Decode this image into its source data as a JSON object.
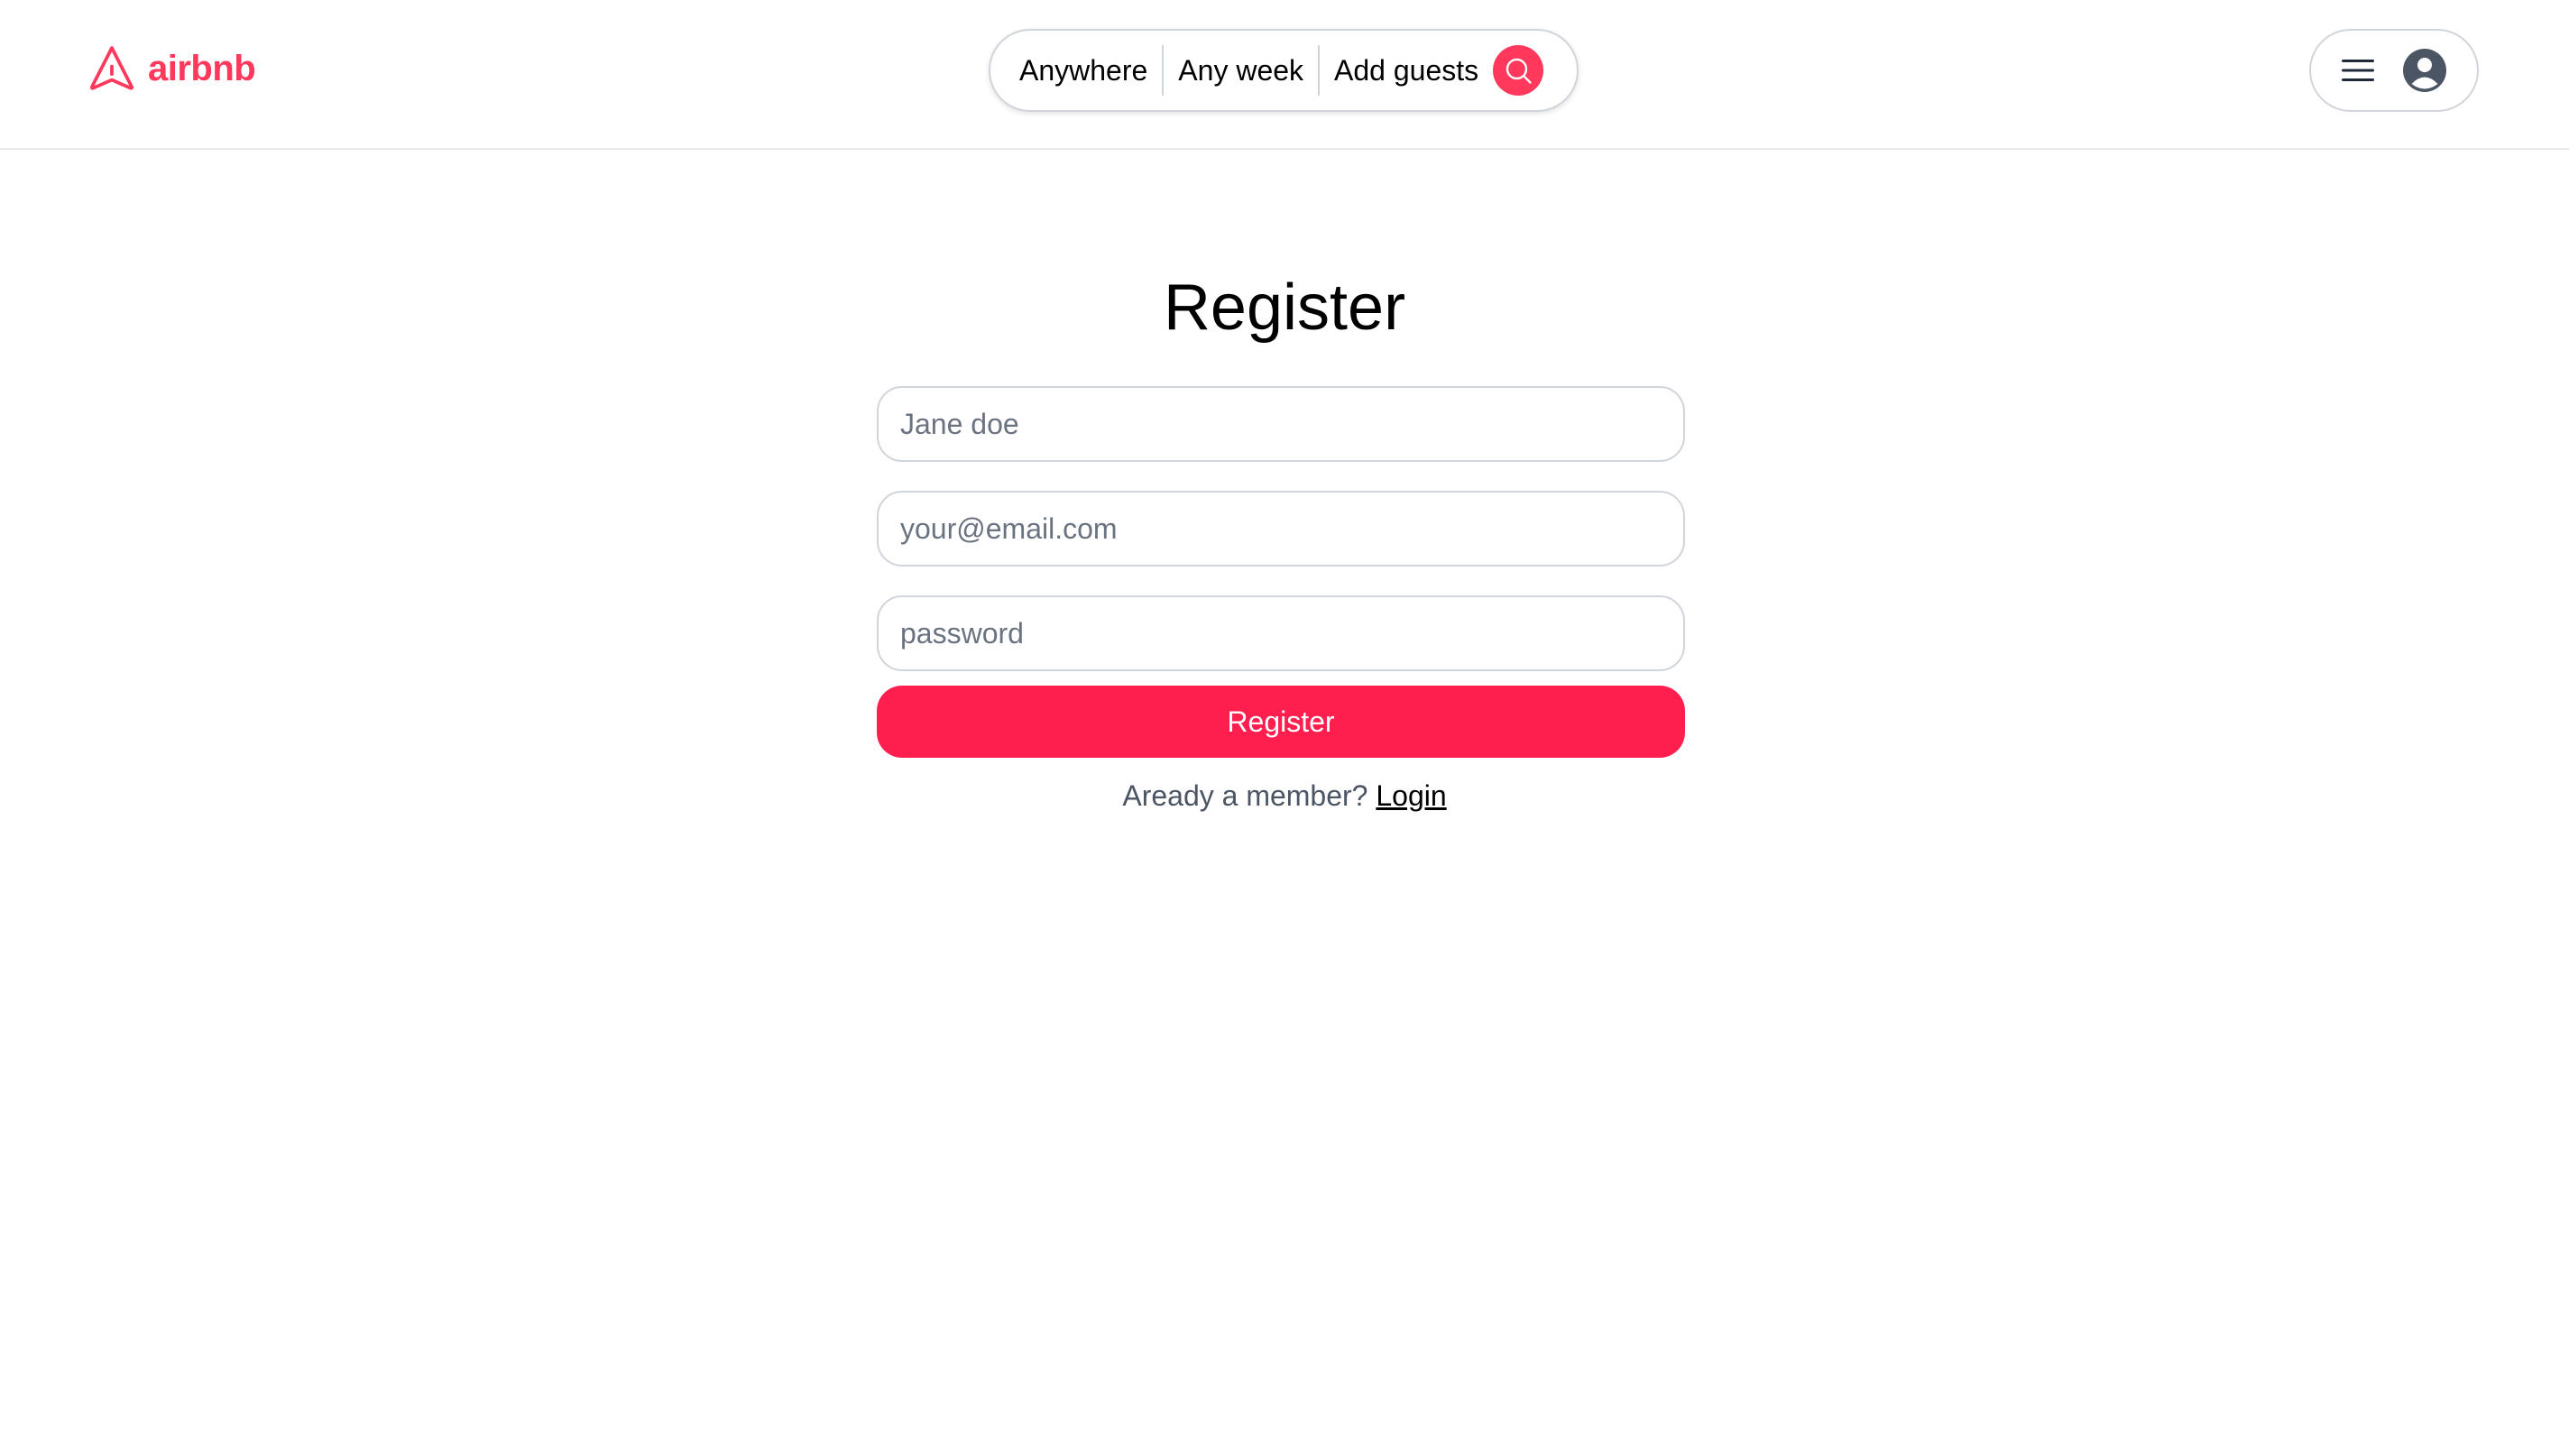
{
  "header": {
    "logo_text": "airbnb",
    "search": {
      "location": "Anywhere",
      "week": "Any week",
      "guests": "Add guests"
    }
  },
  "colors": {
    "brand": "#ff385c",
    "button": "#ff1f4f"
  },
  "icons": {
    "logo": "airbnb-logo-icon",
    "search": "search-icon",
    "menu": "hamburger-menu-icon",
    "avatar": "user-avatar-icon"
  },
  "form": {
    "title": "Register",
    "name_placeholder": "Jane doe",
    "email_placeholder": "your@email.com",
    "password_placeholder": "password",
    "submit_label": "Register",
    "member_prompt": "Aready a member?",
    "login_label": "Login"
  }
}
